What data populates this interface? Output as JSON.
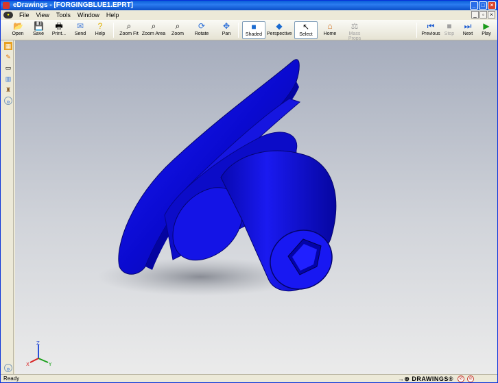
{
  "window": {
    "title": "eDrawings - [FORGINGBLUE1.EPRT]"
  },
  "menu": [
    "File",
    "View",
    "Tools",
    "Window",
    "Help"
  ],
  "toolbar": {
    "open": "Open",
    "save": "Save",
    "print": "Print...",
    "send": "Send",
    "help": "Help",
    "zoom_fit": "Zoom Fit",
    "zoom_area": "Zoom Area",
    "zoom": "Zoom",
    "rotate": "Rotate",
    "pan": "Pan",
    "shaded": "Shaded",
    "perspective": "Perspective",
    "select": "Select",
    "home": "Home",
    "mass_props": "Mass Props",
    "previous": "Previous",
    "stop": "Stop",
    "next": "Next",
    "play": "Play"
  },
  "triad": {
    "x": "X",
    "y": "Y",
    "z": "Z"
  },
  "status": {
    "text": "Ready",
    "brand": "DRAWINGS®"
  },
  "colors": {
    "part": "#1010e8",
    "titlebar": "#0a5fd8"
  }
}
